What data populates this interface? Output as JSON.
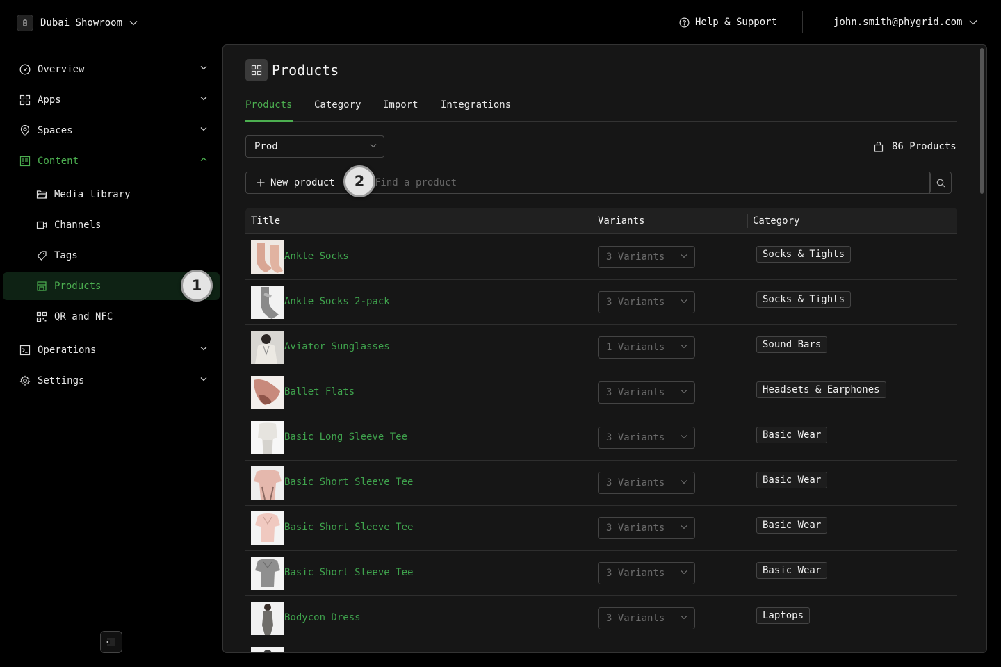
{
  "topbar": {
    "workspace_name": "Dubai Showroom",
    "help_label": "Help & Support",
    "user_email": "john.smith@phygrid.com"
  },
  "sidebar": {
    "items": [
      {
        "label": "Overview",
        "icon": "gauge-icon"
      },
      {
        "label": "Apps",
        "icon": "grid-icon"
      },
      {
        "label": "Spaces",
        "icon": "map-pin-icon"
      },
      {
        "label": "Content",
        "icon": "content-icon"
      },
      {
        "label": "Media library",
        "icon": "folder-icon"
      },
      {
        "label": "Channels",
        "icon": "video-icon"
      },
      {
        "label": "Tags",
        "icon": "tag-icon"
      },
      {
        "label": "Products",
        "icon": "store-icon"
      },
      {
        "label": "QR and NFC",
        "icon": "qr-icon"
      },
      {
        "label": "Operations",
        "icon": "terminal-icon"
      },
      {
        "label": "Settings",
        "icon": "gear-icon"
      }
    ]
  },
  "annotations": {
    "step1": "1",
    "step2": "2"
  },
  "page": {
    "title": "Products",
    "tabs": [
      "Products",
      "Category",
      "Import",
      "Integrations"
    ],
    "environment_select": "Prod",
    "product_count": "86 Products",
    "new_product_label": "New product",
    "search_placeholder": "Find a product"
  },
  "table": {
    "columns": [
      "Title",
      "Variants",
      "Category"
    ],
    "rows": [
      {
        "title": "Ankle Socks",
        "variants": "3 Variants",
        "category": "Socks & Tights"
      },
      {
        "title": "Ankle Socks 2-pack",
        "variants": "3 Variants",
        "category": "Socks & Tights"
      },
      {
        "title": "Aviator Sunglasses",
        "variants": "1 Variants",
        "category": "Sound Bars"
      },
      {
        "title": "Ballet Flats",
        "variants": "3 Variants",
        "category": "Headsets & Earphones"
      },
      {
        "title": "Basic Long Sleeve Tee",
        "variants": "3 Variants",
        "category": "Basic Wear"
      },
      {
        "title": "Basic Short Sleeve Tee",
        "variants": "3 Variants",
        "category": "Basic Wear"
      },
      {
        "title": "Basic Short Sleeve Tee",
        "variants": "3 Variants",
        "category": "Basic Wear"
      },
      {
        "title": "Basic Short Sleeve Tee",
        "variants": "3 Variants",
        "category": "Basic Wear"
      },
      {
        "title": "Bodycon Dress",
        "variants": "3 Variants",
        "category": "Laptops"
      }
    ]
  },
  "colors": {
    "accent": "#4caf50",
    "background": "#000000",
    "panel": "#161616"
  }
}
